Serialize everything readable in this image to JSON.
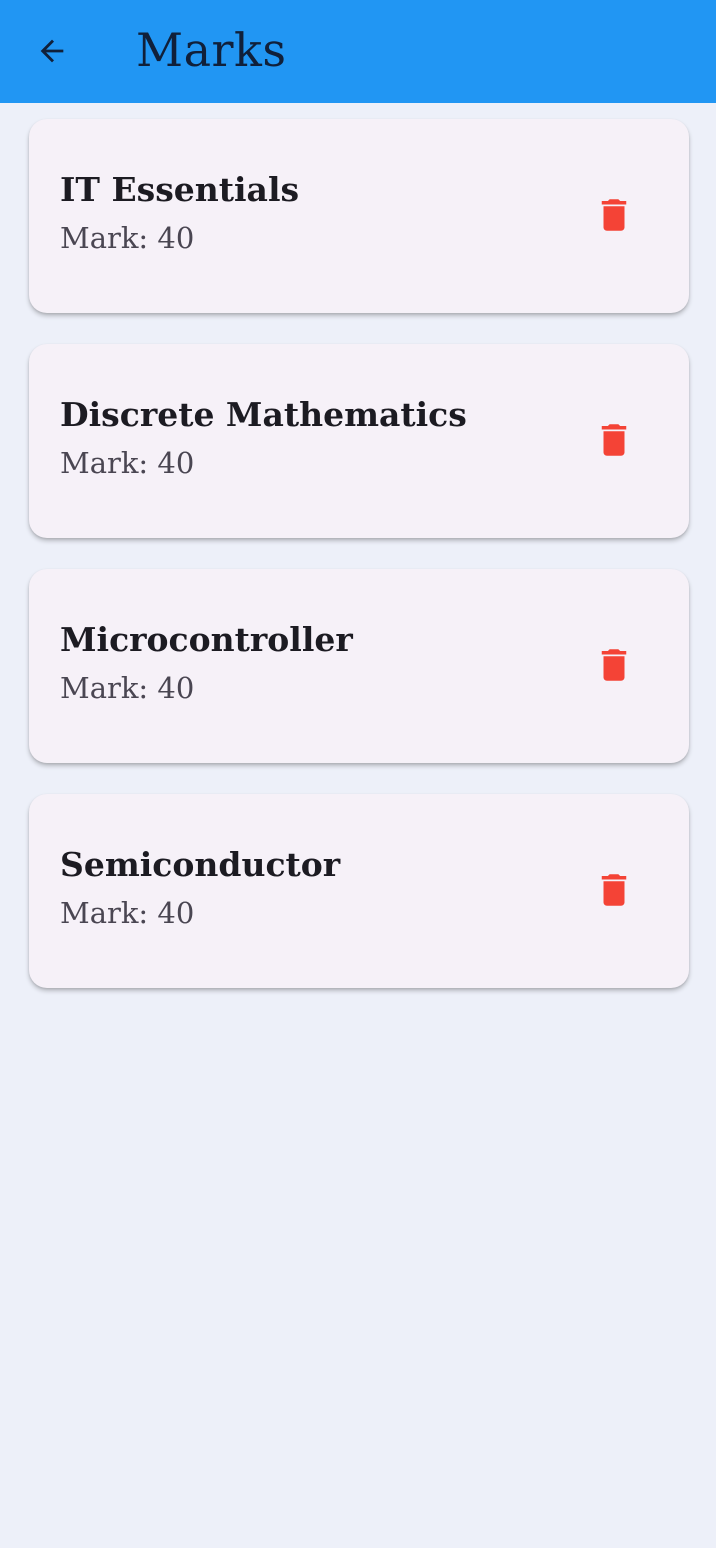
{
  "app_bar": {
    "title": "Marks",
    "background_color": "#2196F3",
    "back_icon": "arrow-back-icon"
  },
  "marks": [
    {
      "subject": "IT Essentials",
      "mark_text": "Mark: 40"
    },
    {
      "subject": "Discrete Mathematics",
      "mark_text": "Mark: 40"
    },
    {
      "subject": "Microcontroller",
      "mark_text": "Mark: 40"
    },
    {
      "subject": "Semiconductor",
      "mark_text": "Mark: 40"
    }
  ],
  "delete_icon": "trash-icon",
  "colors": {
    "page_background": "#EDF0F9",
    "card_background": "#F6F1F8",
    "delete_icon": "#F44336"
  }
}
